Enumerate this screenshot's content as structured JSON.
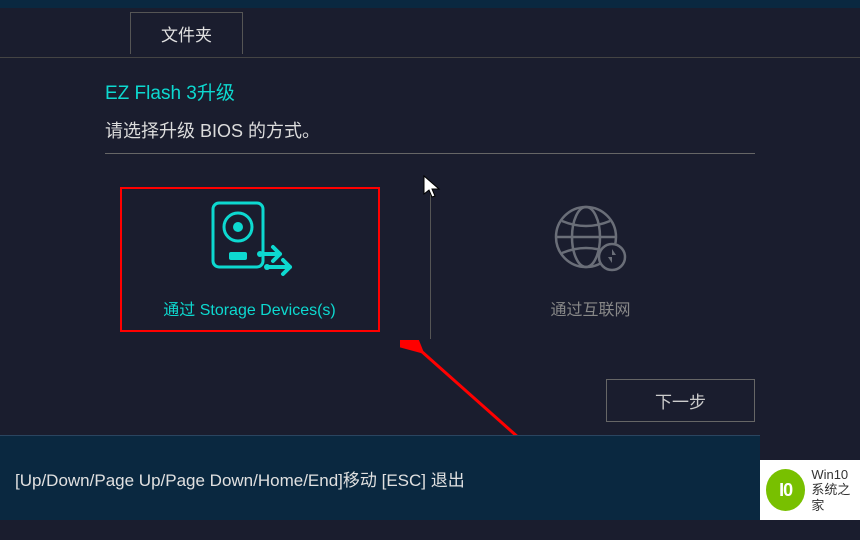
{
  "tab": {
    "label": "文件夹"
  },
  "page": {
    "title": "EZ Flash 3升级",
    "subtitle": "请选择升级 BIOS 的方式。"
  },
  "options": {
    "storage": {
      "label": "通过 Storage Devices(s)"
    },
    "internet": {
      "label": "通过互联网"
    }
  },
  "next_button": "下一步",
  "footer": "[Up/Down/Page Up/Page Down/Home/End]移动 [ESC] 退出",
  "watermark": {
    "logo_text": "I0",
    "line1": "Win10",
    "line2": "系统之家"
  },
  "colors": {
    "accent": "#0dd9d0",
    "highlight_border": "#ff0000"
  }
}
